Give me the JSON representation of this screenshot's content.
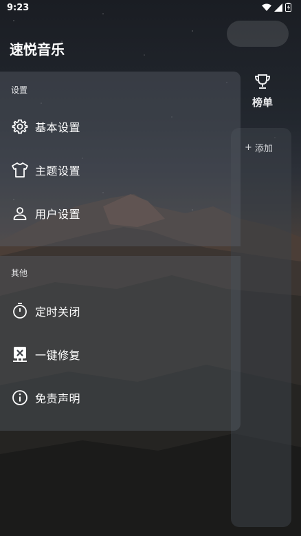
{
  "status_bar": {
    "time": "9:23"
  },
  "drawer": {
    "title": "速悦音乐",
    "settings_section": {
      "label": "设置",
      "items": [
        {
          "label": "基本设置",
          "icon": "gear-icon"
        },
        {
          "label": "主题设置",
          "icon": "shirt-icon"
        },
        {
          "label": "用户设置",
          "icon": "person-icon"
        }
      ]
    },
    "other_section": {
      "label": "其他",
      "items": [
        {
          "label": "定时关闭",
          "icon": "timer-icon"
        },
        {
          "label": "一键修复",
          "icon": "repair-computer-icon"
        },
        {
          "label": "免责声明",
          "icon": "info-icon"
        }
      ]
    }
  },
  "background_app": {
    "ranking_label": "榜单",
    "add_label": "添加",
    "add_symbol": "+"
  }
}
